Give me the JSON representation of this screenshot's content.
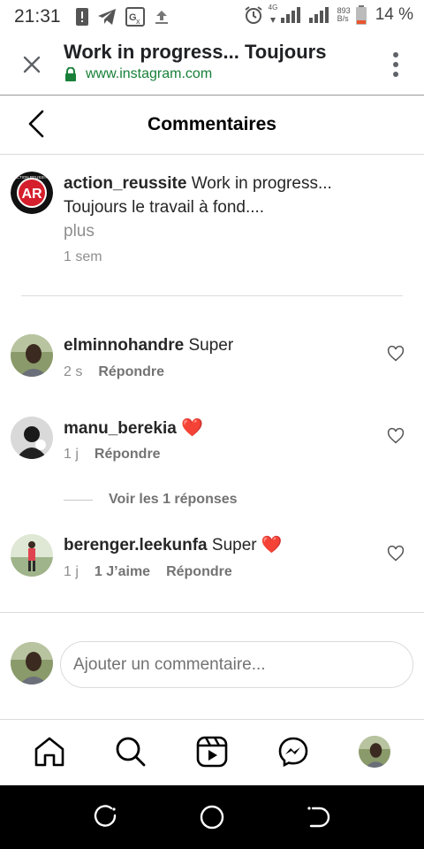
{
  "status_bar": {
    "time": "21:31",
    "network_speed_top": "893",
    "network_speed_bottom": "B/s",
    "network_type": "4G",
    "battery_percent": "14 %"
  },
  "browser": {
    "page_title": "Work in progress... Toujours",
    "url": "www.instagram.com"
  },
  "header": {
    "title": "Commentaires"
  },
  "caption": {
    "username": "action_reussite",
    "text": "Work in progress... Toujours le travail à fond....",
    "more": "plus",
    "time": "1 sem",
    "avatar_letters": "AR",
    "avatar_top_text": "ACTION REUSSITE"
  },
  "comments": [
    {
      "username": "elminnohandre",
      "text": "Super",
      "time": "2 s",
      "reply": "Répondre"
    },
    {
      "username": "manu_berekia",
      "text": "❤️",
      "time": "1 j",
      "reply": "Répondre"
    },
    {
      "username": "berenger.leekunfa",
      "text": "Super ❤️",
      "time": "1 j",
      "likes": "1 J’aime",
      "reply": "Répondre"
    }
  ],
  "replies_toggle": "Voir les 1 réponses",
  "add_comment": {
    "placeholder": "Ajouter un commentaire..."
  },
  "colors": {
    "url_green": "#188038",
    "heart_red": "#ed2f3d",
    "secondary_text": "#8e8e8e"
  },
  "icons": {
    "nav": [
      "home-icon",
      "search-icon",
      "reels-icon",
      "messenger-icon",
      "profile-avatar"
    ]
  }
}
